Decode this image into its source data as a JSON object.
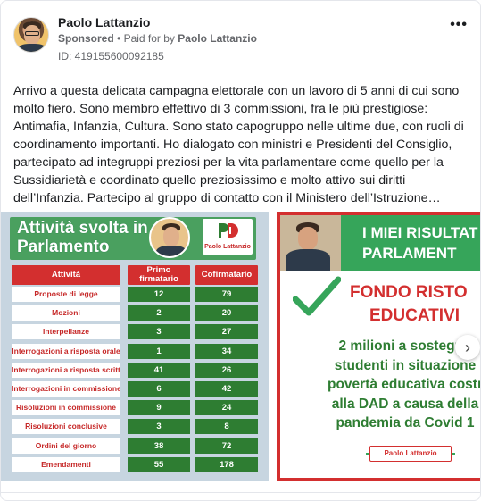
{
  "post": {
    "author": "Paolo Lattanzio",
    "sponsored_label": "Sponsored",
    "separator": "•",
    "paid_for_prefix": "Paid for by",
    "paid_for_name": "Paolo Lattanzio",
    "ad_id": "ID: 419155600092185",
    "more_icon": "more-horizontal-icon",
    "more_label": "•••",
    "body": "Arrivo a questa delicata campagna elettorale con un lavoro di 5 anni di cui sono molto fiero. Sono membro effettivo di 3 commissioni, fra le più prestigiose: Antimafia, Infanzia, Cultura. Sono stato capogruppo nelle ultime due, con ruoli di coordinamento importanti. Ho dialogato con ministri e Presidenti del Consiglio, partecipato ad integruppi preziosi per la vita parlamentare come quello per la Sussidiarietà e coordinato quello preziosissimo e molto attivo sui diritti dell’Infanzia. Partecipo al gruppo di contatto con il Ministero dell’Istruzione…"
  },
  "slide1": {
    "title": "Attività svolta in Parlamento",
    "logo_caption": "Paolo Lattanzio",
    "columns": [
      "Attività",
      "Primo firmatario",
      "Cofirmatario"
    ],
    "rows": [
      {
        "label": "Proposte di legge",
        "primo": "12",
        "cofirmatario": "79"
      },
      {
        "label": "Mozioni",
        "primo": "2",
        "cofirmatario": "20"
      },
      {
        "label": "Interpellanze",
        "primo": "3",
        "cofirmatario": "27"
      },
      {
        "label": "Interrogazioni a risposta orale",
        "primo": "1",
        "cofirmatario": "34"
      },
      {
        "label": "Interrogazioni a risposta scritta",
        "primo": "41",
        "cofirmatario": "26"
      },
      {
        "label": "Interrogazioni in commissione",
        "primo": "6",
        "cofirmatario": "42"
      },
      {
        "label": "Risoluzioni in commissione",
        "primo": "9",
        "cofirmatario": "24"
      },
      {
        "label": "Risoluzioni conclusive",
        "primo": "3",
        "cofirmatario": "8"
      },
      {
        "label": "Ordini del giorno",
        "primo": "38",
        "cofirmatario": "72"
      },
      {
        "label": "Emendamenti",
        "primo": "55",
        "cofirmatario": "178"
      }
    ]
  },
  "slide2": {
    "header_line1": "I MIEI RISULTAT",
    "header_line2": "PARLAMENT",
    "title_line1": "FONDO RISTO",
    "title_line2": "EDUCATIVI",
    "msg_line1": "2 milioni a sostegno",
    "msg_line2": "studenti in situazione",
    "msg_line3": "povertà educativa costr",
    "msg_line4": "alla DAD a causa della",
    "msg_line5": "pandemia da Covid 1",
    "signature": "Paolo Lattanzio"
  },
  "carousel": {
    "next_icon": "chevron-right-icon",
    "next_glyph": "›"
  },
  "colors": {
    "pd_green": "#36a55a",
    "pd_red": "#d32f2f",
    "dark_green": "#2e7d32",
    "meta_gray": "#65676b"
  }
}
